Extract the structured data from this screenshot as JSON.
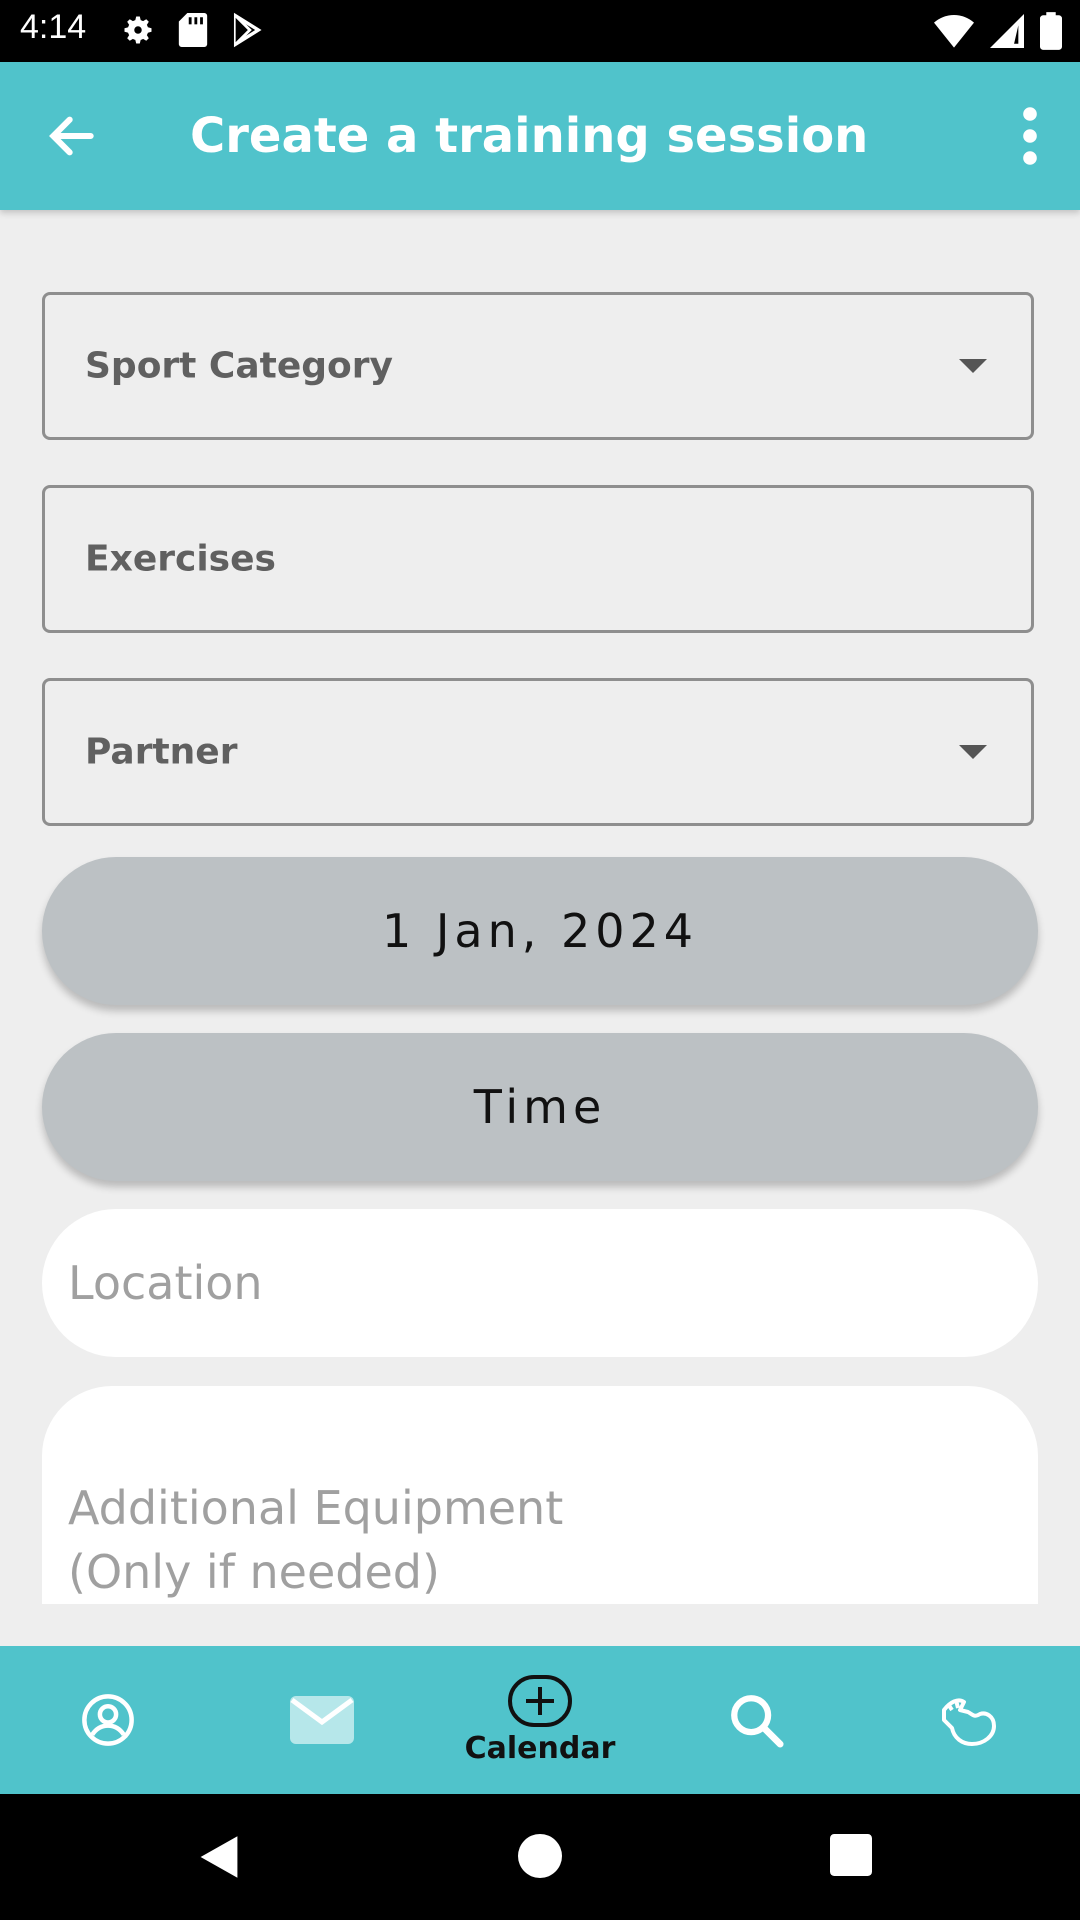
{
  "status_bar": {
    "time": "4:14",
    "left_icons": [
      "gear-icon",
      "sd-card-icon",
      "play-store-icon"
    ],
    "right_icons": [
      "wifi-icon",
      "signal-icon",
      "battery-icon"
    ]
  },
  "app_bar": {
    "title": "Create a training session",
    "back_icon": "arrow-left-icon",
    "menu_icon": "more-vertical-icon",
    "color": "#50c3cb"
  },
  "form": {
    "sport_category": {
      "label": "Sport Category"
    },
    "exercises": {
      "label": "Exercises"
    },
    "partner": {
      "label": "Partner"
    },
    "date_button": {
      "label": "1 Jan, 2024"
    },
    "time_button": {
      "label": "Time"
    },
    "location": {
      "placeholder": "Location"
    },
    "equipment": {
      "placeholder_line1": "Additional Equipment",
      "placeholder_line2": "(Only if needed)"
    }
  },
  "bottom_nav": {
    "items": [
      {
        "icon": "profile-icon"
      },
      {
        "icon": "mail-icon"
      },
      {
        "icon": "add-circle-icon",
        "label": "Calendar",
        "active": true
      },
      {
        "icon": "search-icon"
      },
      {
        "icon": "flex-arm-icon"
      }
    ]
  },
  "system_nav": {
    "icons": [
      "back-triangle-icon",
      "home-circle-icon",
      "recents-square-icon"
    ]
  }
}
